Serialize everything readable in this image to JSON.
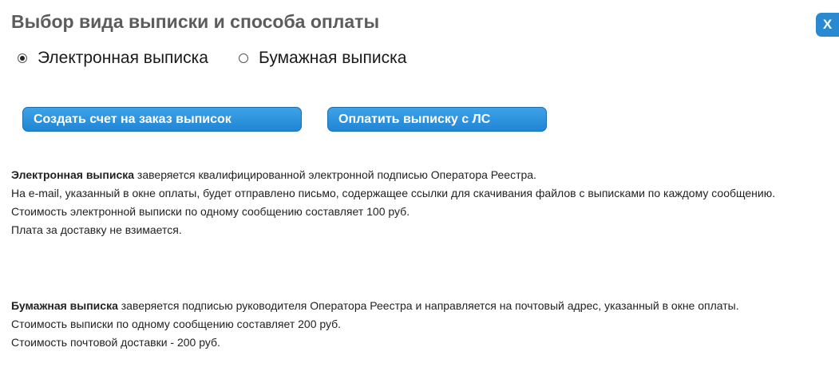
{
  "dialog": {
    "title": "Выбор вида выписки и способа оплаты",
    "close_label": "X"
  },
  "statement_type": {
    "options": [
      {
        "label": "Электронная выписка",
        "selected": true
      },
      {
        "label": "Бумажная выписка",
        "selected": false
      }
    ]
  },
  "buttons": {
    "create_invoice": "Создать счет на заказ выписок",
    "pay_from_account": "Оплатить выписку с ЛС"
  },
  "colors": {
    "button_blue": "#2a8ad1",
    "title_gray": "#5c5c5c"
  },
  "info": {
    "electronic": {
      "term": "Электронная выписка",
      "line1_rest": " заверяется квалифицированной электронной подписью Оператора Реестра.",
      "line2": "На e-mail, указанный в окне оплаты, будет отправлено письмо, содержащее ссылки для скачивания файлов с выписками по каждому сообщению.",
      "line3": "Стоимость электронной выписки по одному сообщению составляет 100 руб.",
      "line4": "Плата за доставку не взимается."
    },
    "paper": {
      "term": "Бумажная выписка",
      "line1_rest": " заверяется подписью руководителя Оператора Реестра и направляется на почтовый адрес, указанный в окне оплаты.",
      "line2": "Стоимость выписки по одному сообщению составляет 200 руб.",
      "line3": "Стоимость почтовой доставки - 200 руб."
    }
  }
}
